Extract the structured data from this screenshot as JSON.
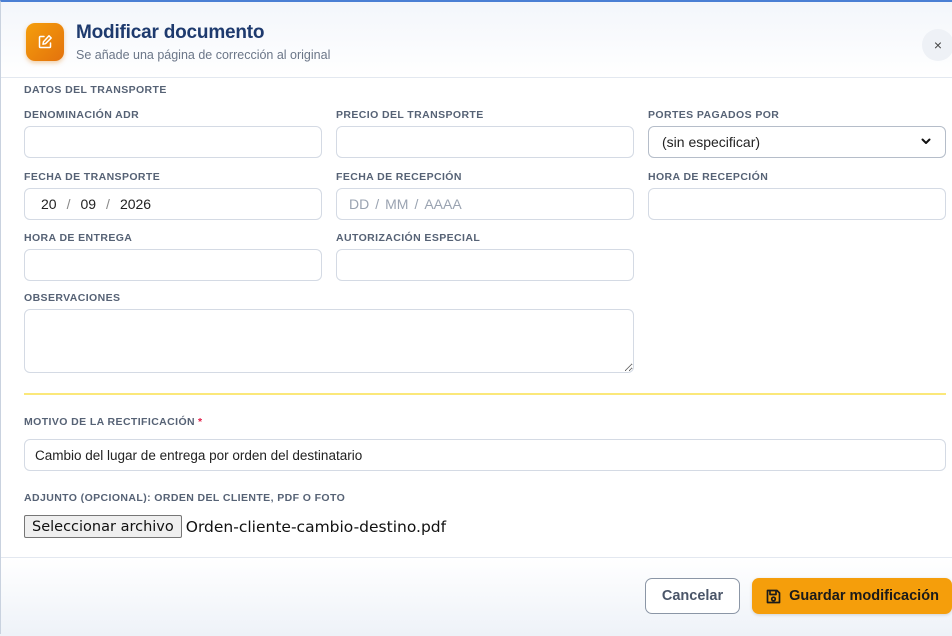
{
  "header": {
    "title": "Modificar documento",
    "subtitle": "Se añade una página de corrección al original",
    "close_label": "×",
    "icon": "edit-icon"
  },
  "transport": {
    "section_title": "DATOS DEL TRANSPORTE",
    "denominacion": {
      "label": "DENOMINACIÓN ADR",
      "value": ""
    },
    "precio": {
      "label": "PRECIO DEL TRANSPORTE",
      "value": ""
    },
    "portes": {
      "label": "PORTES PAGADOS POR",
      "value": "(sin especificar)"
    },
    "fecha_transporte": {
      "label": "FECHA DE TRANSPORTE",
      "day": "20",
      "month": "09",
      "year": "2026",
      "sep": "/"
    },
    "fecha_recepcion": {
      "label": "FECHA DE RECEPCIÓN",
      "day": "DD",
      "month": "MM",
      "year": "AAAA",
      "sep": "/"
    },
    "hora_recepcion": {
      "label": "HORA DE RECEPCIÓN",
      "value": ""
    },
    "hora_entrega": {
      "label": "HORA DE ENTREGA",
      "value": ""
    },
    "autorizacion": {
      "label": "AUTORIZACIÓN ESPECIAL",
      "value": ""
    },
    "observaciones": {
      "label": "OBSERVACIONES",
      "value": ""
    }
  },
  "rectificacion": {
    "label": "MOTIVO DE LA RECTIFICACIÓN",
    "required_mark": "*",
    "value": "Cambio del lugar de entrega por orden del destinatario"
  },
  "attachment": {
    "label": "ADJUNTO (OPCIONAL): ORDEN DEL CLIENTE, PDF O FOTO",
    "button_label": "Seleccionar archivo",
    "file_name": "Orden-cliente-cambio-destino.pdf"
  },
  "footer": {
    "cancel_label": "Cancelar",
    "save_label": "Guardar modificación",
    "save_icon": "save-icon"
  },
  "colors": {
    "accent": "#f59e0b",
    "title": "#1e3a6e",
    "divider": "#fbe87a",
    "required": "#e11d48"
  }
}
